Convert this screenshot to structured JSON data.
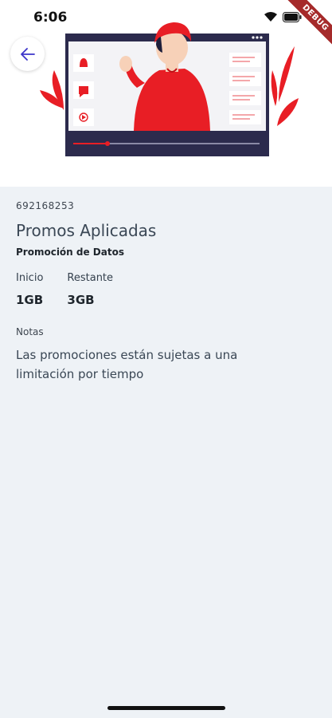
{
  "status_bar": {
    "time": "6:06"
  },
  "debug_banner": "DEBUG",
  "navigation": {
    "back_icon": "arrow-left-icon"
  },
  "account": {
    "number": "692168253"
  },
  "page": {
    "title": "Promos Aplicadas",
    "promo_type": "Promoción de Datos"
  },
  "stats": {
    "start_label": "Inicio",
    "start_value": "1GB",
    "remaining_label": "Restante",
    "remaining_value": "3GB"
  },
  "notes": {
    "label": "Notas",
    "text": "Las promociones están sujetas a una limitación por tiempo"
  },
  "colors": {
    "accent": "#e81e25",
    "back_arrow": "#3d35c9",
    "background": "#eef2f6",
    "video_frame": "#2c2b4d"
  }
}
